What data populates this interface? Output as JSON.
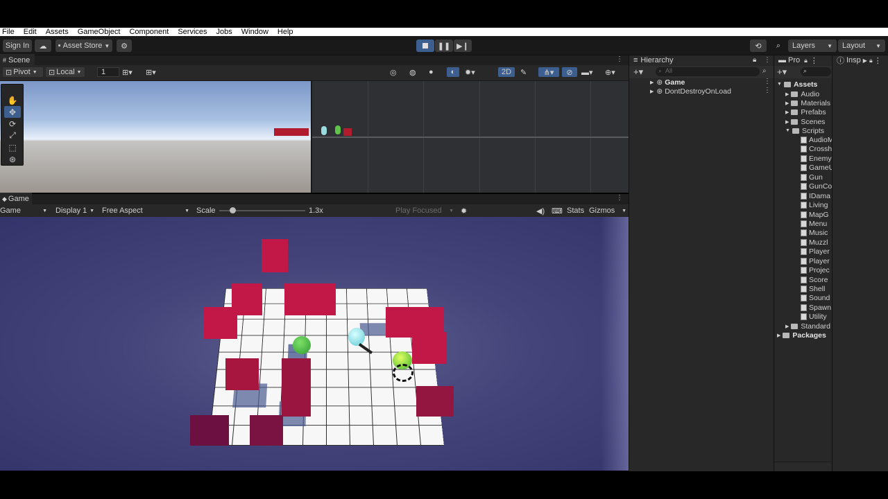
{
  "menu": [
    "File",
    "Edit",
    "Assets",
    "GameObject",
    "Component",
    "Services",
    "Jobs",
    "Window",
    "Help"
  ],
  "toolbar": {
    "sign_in": "Sign In",
    "asset_store": "Asset Store",
    "layers": "Layers",
    "layout": "Layout"
  },
  "scene": {
    "tab": "Scene",
    "pivot": "Pivot",
    "local": "Local",
    "grid_value": "1",
    "mode_2d": "2D"
  },
  "game": {
    "tab": "Game",
    "view_select": "Game",
    "display": "Display 1",
    "aspect": "Free Aspect",
    "scale_label": "Scale",
    "scale_value": "1.3x",
    "play_focused": "Play Focused",
    "stats": "Stats",
    "gizmos": "Gizmos"
  },
  "hierarchy": {
    "tab": "Hierarchy",
    "search_placeholder": "All",
    "items": [
      "Game",
      "DontDestroyOnLoad"
    ]
  },
  "project": {
    "tab": "Pro",
    "assets_root": "Assets",
    "folders": [
      "Audio",
      "Materials",
      "Prefabs",
      "Scenes",
      "Scripts"
    ],
    "scripts": [
      "AudioM",
      "Crossh",
      "Enemy",
      "GameU",
      "Gun",
      "GunCo",
      "IDama",
      "Living",
      "MapG",
      "Menu",
      "Music",
      "Muzzl",
      "Player",
      "Player",
      "Projec",
      "Score",
      "Shell",
      "Sound",
      "Spawn",
      "Utility"
    ],
    "standard": "Standard",
    "packages": "Packages"
  },
  "inspector": {
    "tab": "Insp"
  },
  "colors": {
    "editor_bg": "#282828",
    "accent_blue": "#3d5f8f",
    "block_red": "#c21848",
    "game_bg": "#3c3a6e"
  }
}
